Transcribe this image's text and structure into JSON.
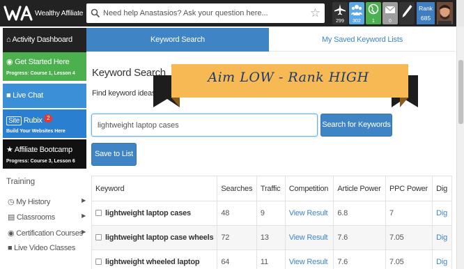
{
  "brand": {
    "logo_text": "Wealthy Affiliate"
  },
  "search": {
    "placeholder": "Need help Anastasios? Ask your question here..."
  },
  "top_icons": [
    {
      "name": "jet-icon",
      "count": "299",
      "color": "#333333"
    },
    {
      "name": "community-icon",
      "count": "302",
      "color": "#5aa9e6"
    },
    {
      "name": "globe-icon",
      "count": "1",
      "color": "#4caf50"
    },
    {
      "name": "mail-icon",
      "count": "0",
      "color": "#9e9e9e"
    },
    {
      "name": "pencil-icon",
      "count": "",
      "color": "#333333"
    }
  ],
  "rank": {
    "label": "Rank",
    "value": "685"
  },
  "sidebar": {
    "activity": "Activity Dashboard",
    "get_started": {
      "title": "Get Started Here",
      "sub": "Progress: Course 1, Lesson 4"
    },
    "live_chat": "Live Chat",
    "siterubix": {
      "badge": "Site",
      "title": "Rubix",
      "count": "2",
      "sub": "Build Your Websites Here"
    },
    "bootcamp": {
      "title": "Affiliate Bootcamp",
      "sub": "Progress: Course 3, Lesson 6"
    },
    "training_label": "Training",
    "training": [
      "My History",
      "Classrooms",
      "Certification Courses",
      "Live Video Classes"
    ]
  },
  "tabs": {
    "active": "Keyword Search",
    "inactive": "My Saved Keyword Lists"
  },
  "main": {
    "title": "Keyword Search",
    "desc": "Find keyword ideas for y",
    "banner": "Aim LOW - Rank HIGH",
    "input_value": "lightweight laptop cases",
    "search_button": "Search for Keywords",
    "save_button": "Save to List"
  },
  "table": {
    "headers": [
      "Keyword",
      "Searches",
      "Traffic",
      "Competition",
      "Article Power",
      "PPC Power",
      "Dig"
    ],
    "rows": [
      {
        "keyword": "lightweight laptop cases",
        "searches": "48",
        "traffic": "9",
        "competition": "View Result",
        "article_power": "6.8",
        "ppc_power": "7",
        "dig": "Dig"
      },
      {
        "keyword": "lightweight laptop case wheels",
        "searches": "72",
        "traffic": "13",
        "competition": "View Result",
        "article_power": "7.6",
        "ppc_power": "7.05",
        "dig": "Dig"
      },
      {
        "keyword": "lightweight wheeled laptop",
        "searches": "64",
        "traffic": "11",
        "competition": "View Result",
        "article_power": "7.6",
        "ppc_power": "7.05",
        "dig": "Dig"
      }
    ]
  },
  "colors": {
    "accent": "#3f85c6",
    "topbar": "#222222",
    "get_started": "#4cb04f",
    "live_chat": "#3a8fd6",
    "siterubix": "#2b7fd1",
    "banner": "#f6b953",
    "banner_text": "#1c3a6e"
  }
}
